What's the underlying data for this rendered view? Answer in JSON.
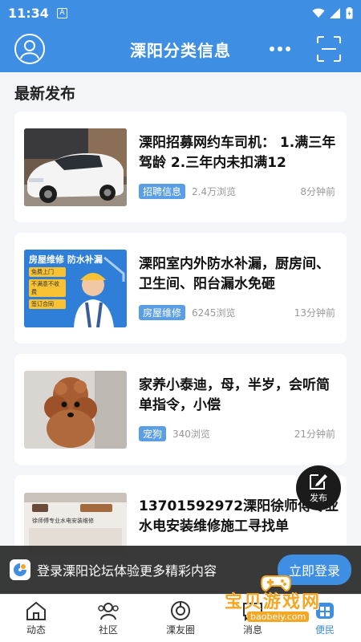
{
  "status_bar": {
    "time": "11:34",
    "notification": "A"
  },
  "header": {
    "title": "溧阳分类信息"
  },
  "section": {
    "title": "最新发布"
  },
  "posts": [
    {
      "title": "溧阳招募网约车司机：  1.满三年驾龄 2.三年内未扣满12",
      "tag": "招聘信息",
      "views": "2.4万浏览",
      "time": "8分钟前",
      "image": "white-car"
    },
    {
      "title": "溧阳室内外防水补漏，厨房间、卫生间、阳台漏水免砸",
      "tag": "房屋维修",
      "views": "6245浏览",
      "time": "13分钟前",
      "image": "repair-worker",
      "image_text": {
        "headline": "房屋维修 防水补漏",
        "items": [
          "免费上门",
          "不满意不收费",
          "签订合同"
        ]
      }
    },
    {
      "title": "家养小泰迪，母，半岁，会听简单指令，小偿",
      "tag": "宠狗",
      "views": "340浏览",
      "time": "21分钟前",
      "image": "brown-poodle"
    },
    {
      "title": "13701592972溧阳徐师傅专业水电安装维修施工寻找单",
      "image": "tools",
      "image_text": {
        "headline": "徐师傅专业水电安装维修"
      }
    }
  ],
  "fab": {
    "label": "发布"
  },
  "login_banner": {
    "text": "登录溧阳论坛体验更多精彩内容",
    "button": "立即登录"
  },
  "tabs": [
    {
      "label": "动态",
      "icon": "home-icon"
    },
    {
      "label": "社区",
      "icon": "community-icon"
    },
    {
      "label": "溧友圈",
      "icon": "circle-icon"
    },
    {
      "label": "消息",
      "icon": "message-icon"
    },
    {
      "label": "便民",
      "icon": "convenience-icon",
      "active": true
    }
  ],
  "watermark": {
    "title": "宝贝游戏网",
    "url": "baobeiy.com"
  },
  "colors": {
    "primary": "#3e8ee4",
    "tag": "#5a9fe6"
  }
}
